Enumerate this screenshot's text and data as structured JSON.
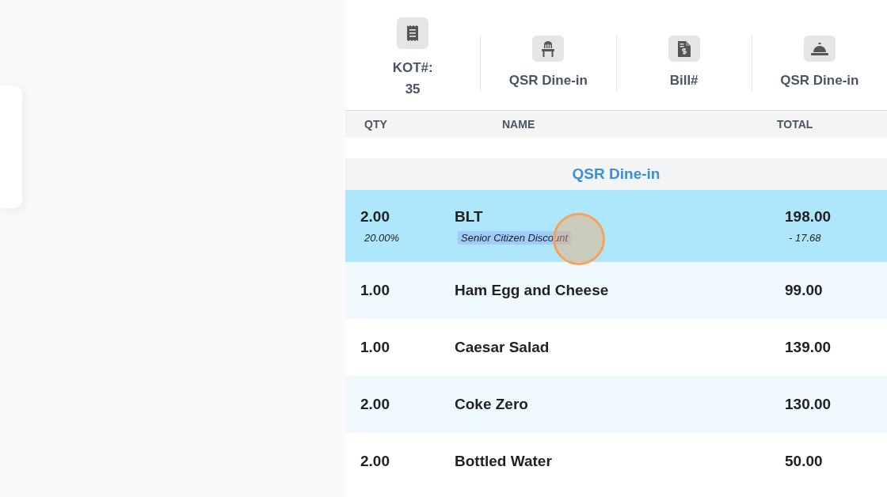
{
  "info_tiles": [
    {
      "kind": "receipt",
      "lines": [
        "KOT#:",
        "35"
      ]
    },
    {
      "kind": "chair",
      "lines": [
        "QSR Dine-in"
      ]
    },
    {
      "kind": "bill",
      "lines": [
        "Bill#"
      ]
    },
    {
      "kind": "bell",
      "lines": [
        "QSR Dine-in"
      ]
    }
  ],
  "table": {
    "columns": [
      "QTY",
      "NAME",
      "TOTAL"
    ],
    "group": "QSR Dine-in",
    "rows": [
      {
        "qty": "2.00",
        "name": "BLT",
        "total": "198.00",
        "selected": true,
        "discount": {
          "percent": "20.00%",
          "label": "Senior Citizen Discount",
          "amount": "- 17.68"
        }
      },
      {
        "qty": "1.00",
        "name": "Ham Egg and Cheese",
        "total": "99.00",
        "selected": false
      },
      {
        "qty": "1.00",
        "name": "Caesar Salad",
        "total": "139.00",
        "selected": false
      },
      {
        "qty": "2.00",
        "name": "Coke Zero",
        "total": "130.00",
        "selected": false
      },
      {
        "qty": "2.00",
        "name": "Bottled Water",
        "total": "50.00",
        "selected": false
      }
    ]
  }
}
